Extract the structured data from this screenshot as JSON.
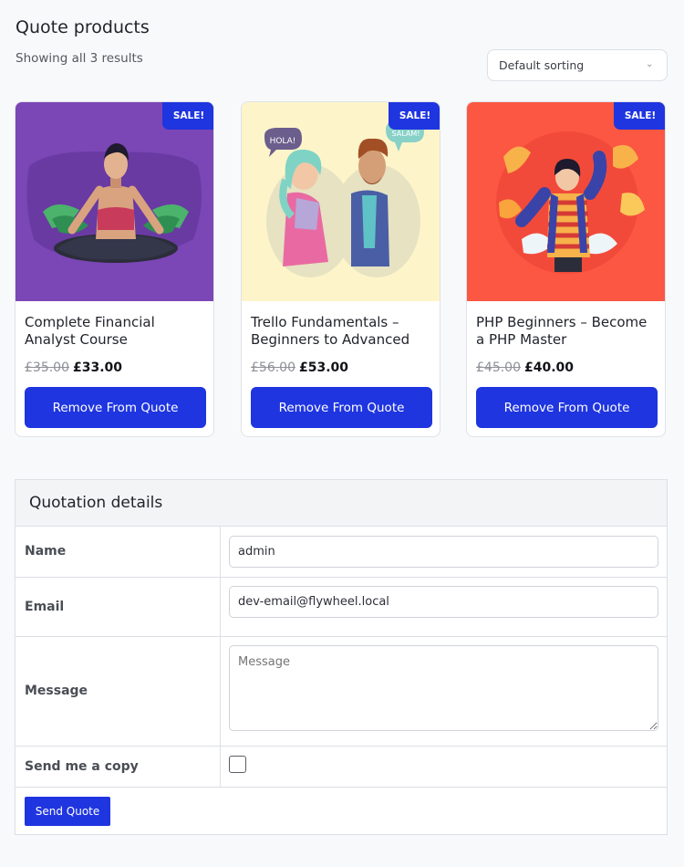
{
  "header": {
    "title": "Quote products",
    "result_count": "Showing all 3 results",
    "sorting": "Default sorting"
  },
  "products": [
    {
      "title": "Complete Financial Analyst Course",
      "old_price": "£35.00",
      "new_price": "£33.00",
      "badge": "SALE!",
      "button": "Remove From Quote",
      "bg_color": "#7b46b5"
    },
    {
      "title": "Trello Fundamentals – Beginners to Advanced",
      "old_price": "£56.00",
      "new_price": "£53.00",
      "badge": "SALE!",
      "button": "Remove From Quote",
      "bg_color": "#fdf5c9",
      "bubble_left": "HOLA!",
      "bubble_right": "SALAM!"
    },
    {
      "title": "PHP Beginners – Become a PHP Master",
      "old_price": "£45.00",
      "new_price": "£40.00",
      "badge": "SALE!",
      "button": "Remove From Quote",
      "bg_color": "#fb5742"
    }
  ],
  "quotation": {
    "heading": "Quotation details",
    "name_label": "Name",
    "name_value": "admin",
    "email_label": "Email",
    "email_value": "dev-email@flywheel.local",
    "message_label": "Message",
    "message_placeholder": "Message",
    "copy_label": "Send me a copy",
    "submit": "Send Quote"
  },
  "colors": {
    "accent": "#1f35e0"
  }
}
